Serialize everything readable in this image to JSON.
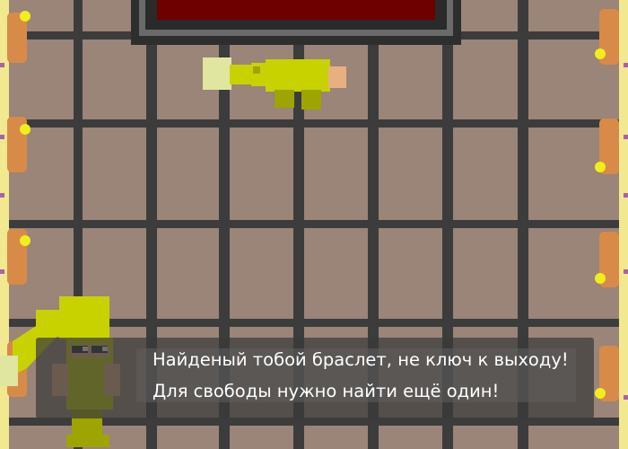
{
  "dialog": {
    "lines": [
      "Найденый тобой браслет, не ключ к выходу!",
      "Для свободы нужно найти ещё один!"
    ]
  },
  "colors": {
    "floor": "#9b8478",
    "grid_lines": "#3c3c3c",
    "wall_border": "#f2e890",
    "wall_dots": "#a862a8",
    "torch": "#d88a48",
    "torch_flame": "#f2ee1a",
    "character_body": "#c8d200",
    "character_dark": "#9ea400",
    "character_skin": "#e8b080",
    "hair_light": "#e0e6a0",
    "pit_fill": "#6e0000",
    "pit_border": "#555555",
    "dialog_bg": "#3a3a3a"
  },
  "icons": {
    "torch": "torch-icon",
    "player": "player-sprite",
    "npc": "npc-portrait",
    "pit": "lava-pit"
  }
}
